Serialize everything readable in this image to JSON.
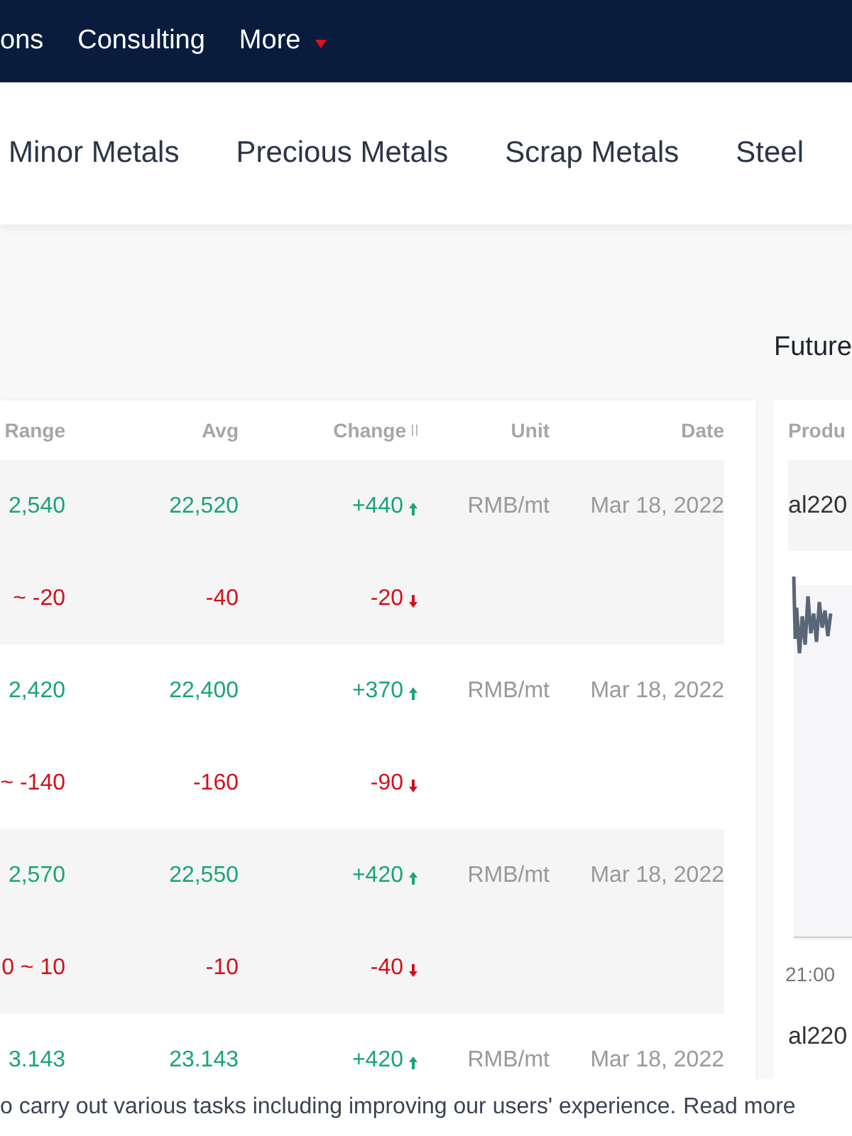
{
  "nav": {
    "items": [
      {
        "label": "ons",
        "kind": "link"
      },
      {
        "label": "Consulting",
        "kind": "link"
      },
      {
        "label": "More",
        "kind": "dropdown"
      }
    ]
  },
  "categories": [
    "Minor Metals",
    "Precious Metals",
    "Scrap Metals",
    "Steel"
  ],
  "futures": {
    "title": "Future",
    "column_header": "Produ",
    "rows": [
      "al220"
    ],
    "axis_label": "21:00",
    "footer_row": "al220"
  },
  "table": {
    "columns": [
      {
        "label": "Range",
        "sortable": false
      },
      {
        "label": "Avg",
        "sortable": false
      },
      {
        "label": "Change",
        "sortable": true
      },
      {
        "label": "Unit",
        "sortable": false
      },
      {
        "label": "Date",
        "sortable": false
      }
    ],
    "groups": [
      {
        "unit": "RMB/mt",
        "date": "Mar 18, 2022",
        "rows": [
          {
            "range": "2,540",
            "avg": "22,520",
            "change": "+440",
            "rising": true
          },
          {
            "range": "~ -20",
            "avg": "-40",
            "change": "-20",
            "rising": false
          }
        ]
      },
      {
        "unit": "RMB/mt",
        "date": "Mar 18, 2022",
        "rows": [
          {
            "range": "2,420",
            "avg": "22,400",
            "change": "+370",
            "rising": true
          },
          {
            "range": "~ -140",
            "avg": "-160",
            "change": "-90",
            "rising": false
          }
        ]
      },
      {
        "unit": "RMB/mt",
        "date": "Mar 18, 2022",
        "rows": [
          {
            "range": "2,570",
            "avg": "22,550",
            "change": "+420",
            "rising": true
          },
          {
            "range": "0 ~ 10",
            "avg": "-10",
            "change": "-40",
            "rising": false
          }
        ]
      },
      {
        "unit": "RMB/mt",
        "date": "Mar 18, 2022",
        "rows": [
          {
            "range": "3.143",
            "avg": "23.143",
            "change": "+420",
            "rising": true
          }
        ]
      }
    ]
  },
  "cookie_notice": {
    "text": "o carry out various tasks including improving our users' experience.",
    "link": "Read more"
  }
}
